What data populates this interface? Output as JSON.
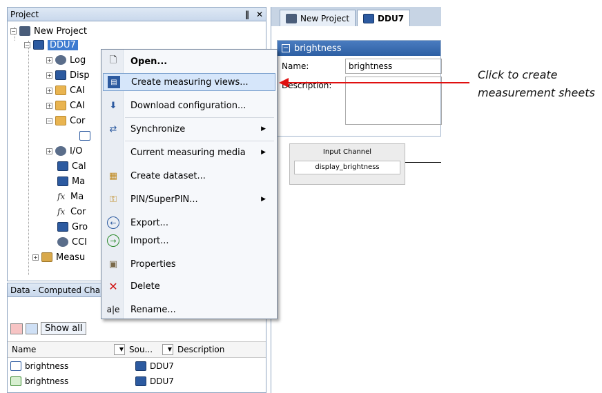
{
  "project_panel": {
    "title": "Project",
    "pin_symbol": "‖",
    "close_symbol": "✕",
    "tree": [
      {
        "label": "New Project"
      },
      {
        "label": "DDU7"
      },
      {
        "label": "Log"
      },
      {
        "label": "Disp"
      },
      {
        "label": "CAI"
      },
      {
        "label": "CAI"
      },
      {
        "label": "Cor"
      },
      {
        "label": ""
      },
      {
        "label": "I/O"
      },
      {
        "label": "Cal"
      },
      {
        "label": "Ma"
      },
      {
        "label": "Ma"
      },
      {
        "label": "Cor"
      },
      {
        "label": "Gro"
      },
      {
        "label": "CCI"
      },
      {
        "label": "Measu"
      }
    ]
  },
  "data_panel": {
    "title": "Data - Computed Char",
    "show_all": "Show all",
    "columns": {
      "name": "Name",
      "source": "Sou...",
      "description": "Description"
    },
    "rows": [
      {
        "name": "brightness",
        "source": "DDU7"
      },
      {
        "name": "brightness",
        "source": "DDU7"
      }
    ]
  },
  "editor": {
    "tabs": [
      "New Project",
      "DDU7"
    ],
    "section_title": "brightness",
    "name_label": "Name:",
    "name_value": "brightness",
    "description_label": "Description:",
    "channel_title": "Input Channel",
    "channel_value": "display_brightness"
  },
  "context_menu": {
    "items": [
      {
        "label": "Open...",
        "bold": true
      },
      {
        "label": "Create measuring views..."
      },
      {
        "label": "Download configuration..."
      },
      {
        "label": "Synchronize"
      },
      {
        "label": "Current measuring media"
      },
      {
        "label": "Create dataset..."
      },
      {
        "label": "PIN/SuperPIN..."
      },
      {
        "label": "Export..."
      },
      {
        "label": "Import..."
      },
      {
        "label": "Properties"
      },
      {
        "label": "Delete"
      },
      {
        "label": "Rename..."
      }
    ],
    "submenu_arrow": "▶"
  },
  "annotation": {
    "line1": "Click to create",
    "line2": "measurement sheets",
    "arrow_color": "#e01010"
  }
}
